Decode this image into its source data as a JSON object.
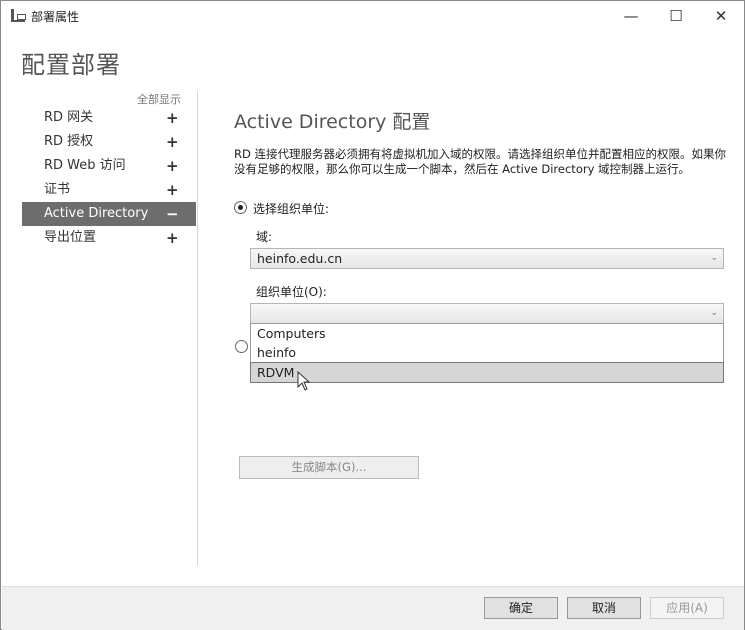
{
  "window": {
    "title": "部署属性",
    "minimize": "—",
    "maximize": "☐",
    "close": "✕"
  },
  "page_title": "配置部署",
  "sidebar": {
    "show_all": "全部显示",
    "items": [
      {
        "label": "RD 网关",
        "toggle": "+"
      },
      {
        "label": "RD 授权",
        "toggle": "+"
      },
      {
        "label": "RD Web 访问",
        "toggle": "+"
      },
      {
        "label": "证书",
        "toggle": "+"
      },
      {
        "label": "Active Directory",
        "toggle": "−",
        "active": true
      },
      {
        "label": "导出位置",
        "toggle": "+"
      }
    ]
  },
  "main": {
    "heading": "Active Directory 配置",
    "description": "RD 连接代理服务器必须拥有将虚拟机加入域的权限。请选择组织单位并配置相应的权限。如果你没有足够的权限，那么你可以生成一个脚本，然后在 Active Directory 域控制器上运行。",
    "radio_select_ou": "选择组织单位:",
    "domain_label": "域:",
    "domain_value": "heinfo.edu.cn",
    "ou_label": "组织单位(O):",
    "ou_value": "",
    "ou_options": [
      "Computers",
      "heinfo",
      "RDVM"
    ],
    "ou_highlighted": "RDVM",
    "generate_script": "生成脚本(G)..."
  },
  "footer": {
    "ok": "确定",
    "cancel": "取消",
    "apply": "应用(A)"
  }
}
